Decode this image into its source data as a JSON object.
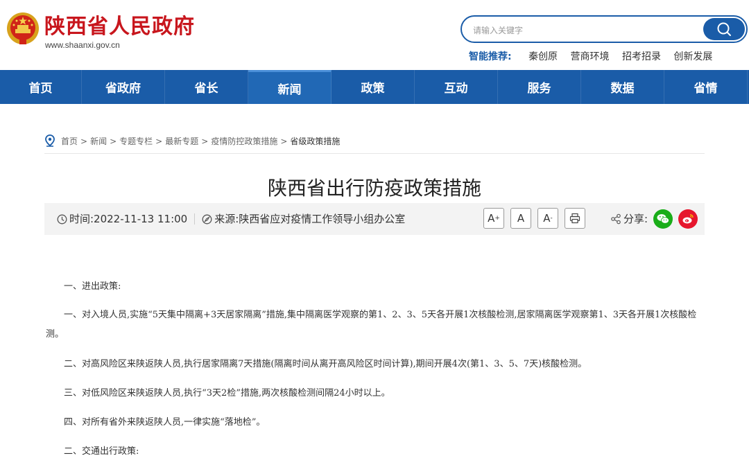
{
  "header": {
    "site_name": "陕西省人民政府",
    "site_url": "www.shaanxi.gov.cn",
    "search_placeholder": "请输入关键字",
    "recommend_label": "智能推荐:",
    "recommend_links": [
      "秦创原",
      "营商环境",
      "招考招录",
      "创新发展"
    ]
  },
  "nav": {
    "items": [
      "首页",
      "省政府",
      "省长",
      "新闻",
      "政策",
      "互动",
      "服务",
      "数据",
      "省情"
    ],
    "active": "新闻"
  },
  "breadcrumb": [
    "首页",
    "新闻",
    "专题专栏",
    "最新专题",
    "疫情防控政策措施",
    "省级政策措施"
  ],
  "article": {
    "title": "陕西省出行防疫政策措施",
    "time": "时间:2022-11-13 11:00",
    "source": "来源:陕西省应对疫情工作领导小组办公室",
    "font_large": "A",
    "font_normal": "A",
    "font_small": "A",
    "share_label": "分享:",
    "paragraphs": [
      "一、进出政策:",
      "一、对入境人员,实施“5天集中隔离+3天居家隔离”措施,集中隔离医学观察的第1、2、3、5天各开展1次核酸检测,居家隔离医学观察第1、3天各开展1次核酸检测。",
      "二、对高风险区来陕返陕人员,执行居家隔离7天措施(隔离时间从离开高风险区时间计算),期间开展4次(第1、3、5、7天)核酸检测。",
      "三、对低风险区来陕返陕人员,执行“3天2检”措施,两次核酸检测间隔24小时以上。",
      "四、对所有省外来陕返陕人员,一律实施“落地检”。",
      "二、交通出行政策:"
    ]
  },
  "colors": {
    "brand_red": "#c8161d",
    "brand_blue": "#1a5ca8",
    "wechat_green": "#1aad19",
    "weibo_red": "#e6162d"
  }
}
